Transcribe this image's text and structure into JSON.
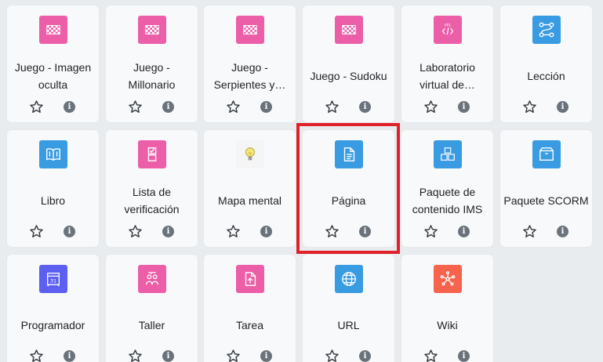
{
  "colors": {
    "pink": "#ec5fa8",
    "blue": "#399be2",
    "purple": "#5c5ff0",
    "orange": "#f7634d",
    "neutral": "#f5f5f5",
    "highlight": "#e0212a"
  },
  "star_label": "Favorito",
  "info_label": "i",
  "items": [
    {
      "label": "Juego - Imagen oculta",
      "icon": "game-icon",
      "color": "#ec5fa8"
    },
    {
      "label": "Juego - Millonario",
      "icon": "game-icon",
      "color": "#ec5fa8"
    },
    {
      "label": "Juego - Serpientes y…",
      "icon": "game-icon",
      "color": "#ec5fa8"
    },
    {
      "label": "Juego - Sudoku",
      "icon": "game-icon",
      "color": "#ec5fa8"
    },
    {
      "label": "Laboratorio virtual de…",
      "icon": "vpl-icon",
      "color": "#ec5fa8"
    },
    {
      "label": "Lección",
      "icon": "lesson-icon",
      "color": "#399be2"
    },
    {
      "label": "Libro",
      "icon": "book-icon",
      "color": "#399be2"
    },
    {
      "label": "Lista de verificación",
      "icon": "checklist-icon",
      "color": "#ec5fa8"
    },
    {
      "label": "Mapa mental",
      "icon": "lightbulb-icon",
      "color": "#f5f5f5"
    },
    {
      "label": "Página",
      "icon": "page-icon",
      "color": "#399be2"
    },
    {
      "label": "Paquete de contenido IMS",
      "icon": "ims-package-icon",
      "color": "#399be2"
    },
    {
      "label": "Paquete SCORM",
      "icon": "scorm-package-icon",
      "color": "#399be2"
    },
    {
      "label": "Programador",
      "icon": "calendar-icon",
      "color": "#5c5ff0"
    },
    {
      "label": "Taller",
      "icon": "workshop-icon",
      "color": "#ec5fa8"
    },
    {
      "label": "Tarea",
      "icon": "assignment-icon",
      "color": "#ec5fa8"
    },
    {
      "label": "URL",
      "icon": "globe-icon",
      "color": "#399be2"
    },
    {
      "label": "Wiki",
      "icon": "wiki-icon",
      "color": "#f7634d"
    }
  ],
  "selected": "Página"
}
